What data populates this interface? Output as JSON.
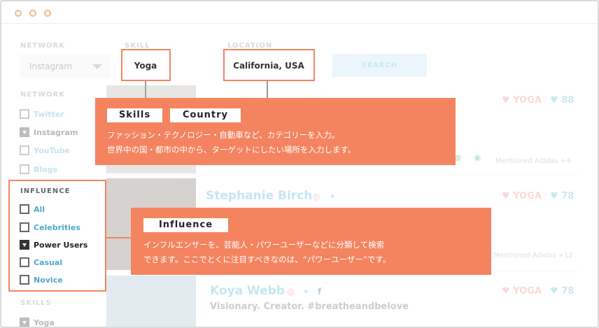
{
  "filters": {
    "network_label": "NETWORK",
    "network_value": "Instagram",
    "skill_label": "SKILL",
    "skill_value": "Yoga",
    "location_label": "LOCATION",
    "location_value": "California, USA",
    "search_label": "SEARCH"
  },
  "sidebar": {
    "network_heading": "NETWORK",
    "network_items": [
      {
        "label": "Twitter",
        "checked": false
      },
      {
        "label": "Instagram",
        "checked": true
      },
      {
        "label": "YouTube",
        "checked": false
      },
      {
        "label": "Blogs",
        "checked": false
      }
    ],
    "influence_heading": "INFLUENCE",
    "influence_items": [
      {
        "label": "All",
        "checked": false
      },
      {
        "label": "Celebrities",
        "checked": false
      },
      {
        "label": "Power Users",
        "checked": true
      },
      {
        "label": "Casual",
        "checked": false
      },
      {
        "label": "Novice",
        "checked": false
      }
    ],
    "skills_heading": "SKILLS",
    "skills_items": [
      {
        "label": "Yoga",
        "checked": true
      }
    ]
  },
  "results": [
    {
      "name": "",
      "skill": "YOGA",
      "count": "88",
      "mention": "Mentioned Adidas +4"
    },
    {
      "name": "Stephanie Birch",
      "skill": "YOGA",
      "count": "78",
      "mention": "Mentioned Adidas +12"
    },
    {
      "name": "Koya Webb",
      "skill": "YOGA",
      "count": "78",
      "bio": "Visionary. Creator. #breatheandbelove"
    }
  ],
  "callouts": {
    "skills_tag": "Skills",
    "country_tag": "Country",
    "skills_line1": "ファッション・テクノロジー・自動車など、カテゴリーを入力。",
    "skills_line2": "世界中の国・都市の中から、ターゲットにしたい場所を入力します。",
    "influence_tag": "Influence",
    "influence_line1": "インフルエンサーを、芸能人・パワーユーザーなどに分類して検索",
    "influence_line2": "できます。ここでとくに注目すべきなのは、“パワーユーザー”です。"
  },
  "colors": {
    "accent_orange": "#f4845f",
    "link_blue": "#4fb3dc",
    "skill_pink": "#f08a8a"
  },
  "icons": {
    "skill": "heart-icon",
    "count": "heart-icon",
    "instagram": "instagram-icon",
    "twitter": "twitter-icon",
    "facebook": "facebook-icon",
    "spotify": "spotify-icon"
  }
}
